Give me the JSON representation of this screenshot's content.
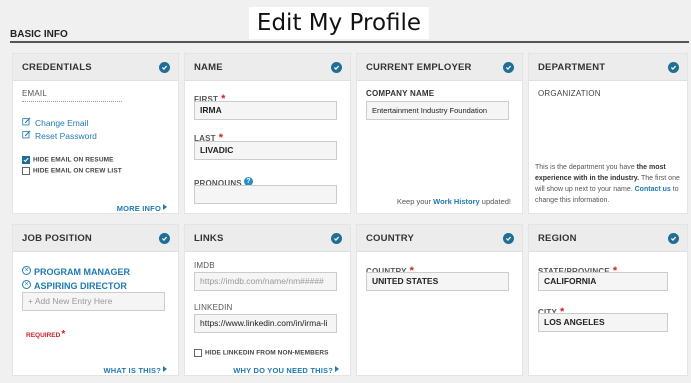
{
  "page": {
    "title": "Edit My Profile",
    "section": "BASIC INFO"
  },
  "credentials": {
    "header": "CREDENTIALS",
    "email_label": "EMAIL",
    "email_value": "",
    "change_email": "Change Email",
    "reset_password": "Reset Password",
    "hide_email_resume": "HIDE EMAIL ON RESUME",
    "hide_email_resume_checked": true,
    "hide_email_crew": "HIDE EMAIL ON CREW LIST",
    "hide_email_crew_checked": false,
    "more_info": "MORE INFO"
  },
  "name": {
    "header": "NAME",
    "first_label": "FIRST",
    "first_value": "IRMA",
    "last_label": "LAST",
    "last_value": "LIVADIC",
    "pronouns_label": "PRONOUNS",
    "pronouns_value": ""
  },
  "employer": {
    "header": "CURRENT EMPLOYER",
    "company_label": "COMPANY NAME",
    "company_value": "Entertainment Industry Foundation",
    "footer_prefix": "Keep your",
    "footer_link": "Work History",
    "footer_suffix": "updated!"
  },
  "department": {
    "header": "DEPARTMENT",
    "org_label": "ORGANIZATION",
    "desc_prefix": "This is the department you have",
    "desc_bold": "the most experience with in the industry.",
    "desc_suffix": "The first one will show up next to your name.",
    "contact_link": "Contact us",
    "contact_suffix": "to change this information."
  },
  "job": {
    "header": "JOB POSITION",
    "items": [
      "PROGRAM MANAGER",
      "ASPIRING DIRECTOR"
    ],
    "add_placeholder": "+ Add New Entry Here",
    "required": "REQUIRED",
    "what_is_this": "WHAT IS THIS?"
  },
  "links": {
    "header": "LINKS",
    "imdb_label": "IMDB",
    "imdb_placeholder": "https://imdb.com/name/nm#####",
    "linkedin_label": "LINKEDIN",
    "linkedin_value": "https://www.linkedin.com/in/irma-li",
    "hide_linkedin": "HIDE LINKEDIN FROM NON-MEMBERS",
    "why": "WHY DO YOU NEED THIS?"
  },
  "country": {
    "header": "COUNTRY",
    "label": "COUNTRY",
    "value": "UNITED STATES"
  },
  "region": {
    "header": "REGION",
    "state_label": "STATE/PROVINCE",
    "state_value": "CALIFORNIA",
    "city_label": "CITY",
    "city_value": "LOS ANGELES"
  },
  "colors": {
    "accent": "#1f7ab3",
    "check": "#1f6e96",
    "required": "#d01f25"
  }
}
